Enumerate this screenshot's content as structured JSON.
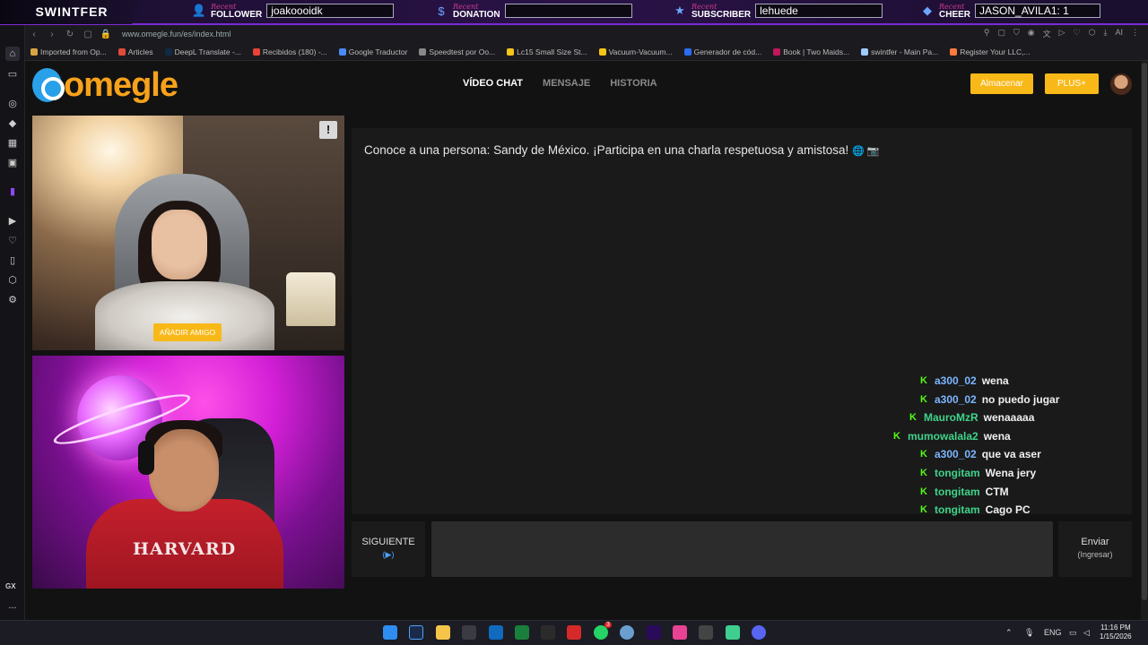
{
  "overlay": {
    "brand": "SWINTFER",
    "recent": "Recent",
    "follower": {
      "kind": "FOLLOWER",
      "value": "joakoooidk"
    },
    "donation": {
      "kind": "DONATION",
      "value": ""
    },
    "subscriber": {
      "kind": "SUBSCRIBER",
      "value": "lehuede"
    },
    "cheer": {
      "kind": "CHEER",
      "value": "JASON_AVILA1: 1"
    }
  },
  "browser": {
    "url": "www.omegle.fun/es/index.html",
    "bookmarks": [
      {
        "label": "Imported from Op...",
        "color": "#d9a441"
      },
      {
        "label": "Articles",
        "color": "#e24b3b"
      },
      {
        "label": "DeepL Translate -...",
        "color": "#0f2b46"
      },
      {
        "label": "Recibidos (180) -...",
        "color": "#ea4335"
      },
      {
        "label": "Google Traductor",
        "color": "#4a8af4"
      },
      {
        "label": "Speedtest por Oo...",
        "color": "#888888"
      },
      {
        "label": "Lc15 Small Size St...",
        "color": "#f5c518"
      },
      {
        "label": "Vacuum-Vacuum...",
        "color": "#f5c518"
      },
      {
        "label": "Generador de cód...",
        "color": "#2a6bf2"
      },
      {
        "label": "Book | Two Maids...",
        "color": "#c2185b"
      },
      {
        "label": "swintfer - Main Pa...",
        "color": "#9ecbff"
      },
      {
        "label": "Register Your LLC,...",
        "color": "#ff7a3c"
      }
    ],
    "sidebar_gx": "GX",
    "sidebar_more": "..."
  },
  "site": {
    "logo_text": "omegle",
    "nav": [
      "VÍDEO CHAT",
      "MENSAJE",
      "HISTORIA"
    ],
    "store_button": "Almacenar",
    "plus_button": "PLUS+",
    "report_button": "!",
    "add_friend_button": "AÑADIR AMIGO",
    "hoodie_text": "HARVARD",
    "intro_text": "Conoce a una persona: Sandy de México. ¡Participa en una charla respetuosa y amistosa!",
    "intro_emojis": "🌐 📷",
    "next_button": {
      "label": "SIGUIENTE",
      "hint": "(▶)"
    },
    "send_button": {
      "label": "Enviar",
      "hint": "(Ingresar)"
    }
  },
  "stream_chat": [
    {
      "user": "a300_02",
      "msg": "wena",
      "user_color": "#7bb6ff"
    },
    {
      "user": "a300_02",
      "msg": "no puedo jugar",
      "user_color": "#7bb6ff"
    },
    {
      "user": "MauroMzR",
      "msg": "wenaaaaa",
      "user_color": "#3fd38a"
    },
    {
      "user": "mumowalala2",
      "msg": "wena",
      "user_color": "#3fd38a"
    },
    {
      "user": "a300_02",
      "msg": "que va aser",
      "user_color": "#7bb6ff"
    },
    {
      "user": "tongitam",
      "msg": "Wena jery",
      "user_color": "#3fd38a"
    },
    {
      "user": "tongitam",
      "msg": "CTM",
      "user_color": "#3fd38a"
    },
    {
      "user": "tongitam",
      "msg": "Cago PC",
      "user_color": "#3fd38a"
    }
  ],
  "taskbar": {
    "lang": "ENG",
    "time": "11:16 PM",
    "date": "1/15/2026",
    "whatsapp_badge": "3"
  },
  "colors": {
    "accent_yellow": "#f8b918",
    "overlay_purple": "#7a2bd6",
    "kick_green": "#53fc18"
  }
}
